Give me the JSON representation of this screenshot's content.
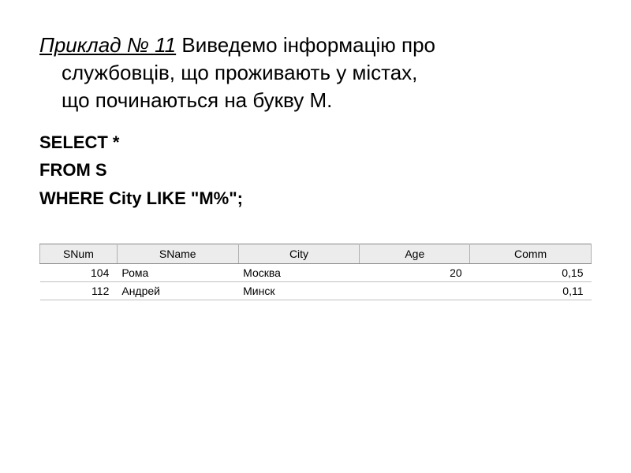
{
  "heading": {
    "example_label": "Приклад № 11",
    "description_line1": " Виведемо інформацію про",
    "description_line2": "службовців, що проживають у містах,",
    "description_line3": "що починаються на букву М."
  },
  "sql": {
    "line1": "SELECT *",
    "line2": "FROM S",
    "line3": "WHERE City LIKE \"М%\";"
  },
  "table": {
    "headers": {
      "snum": "SNum",
      "sname": "SName",
      "city": "City",
      "age": "Age",
      "comm": "Comm"
    },
    "rows": [
      {
        "snum": "104",
        "sname": "Рома",
        "city": "Москва",
        "age": "20",
        "comm": "0,15"
      },
      {
        "snum": "112",
        "sname": "Андрей",
        "city": "Минск",
        "age": "",
        "comm": "0,11"
      }
    ]
  }
}
